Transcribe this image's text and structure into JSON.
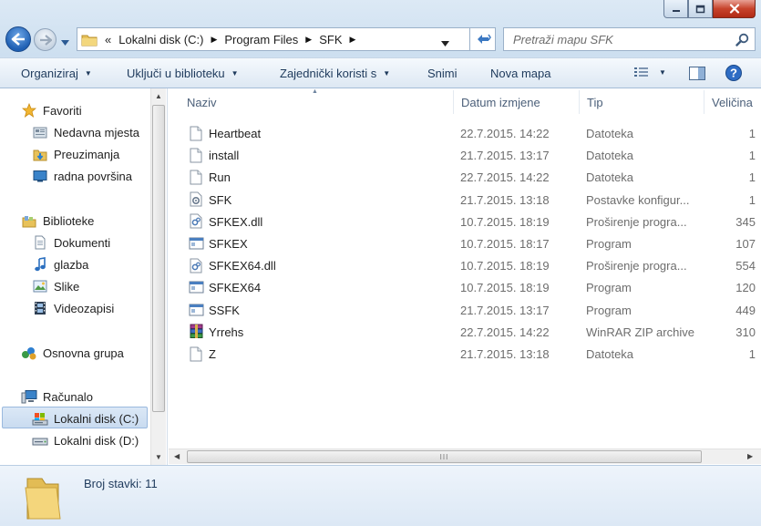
{
  "window": {
    "colors": {
      "accent": "#1e5fb3",
      "close": "#c7432c",
      "selection": "#cce0f6"
    }
  },
  "address": {
    "overflow": "«",
    "crumbs": [
      "Lokalni disk (C:)",
      "Program Files",
      "SFK"
    ]
  },
  "search": {
    "placeholder": "Pretraži mapu SFK"
  },
  "toolbar": {
    "organize": "Organiziraj",
    "include": "Uključi u biblioteku",
    "share": "Zajednički koristi s",
    "burn": "Snimi",
    "new_folder": "Nova mapa"
  },
  "nav": {
    "favorites": "Favoriti",
    "recent": "Nedavna mjesta",
    "downloads": "Preuzimanja",
    "desktop": "radna površina",
    "libraries": "Biblioteke",
    "documents": "Dokumenti",
    "music": "glazba",
    "pictures": "Slike",
    "videos": "Videozapisi",
    "homegroup": "Osnovna grupa",
    "computer": "Računalo",
    "drive_c": "Lokalni disk (C:)",
    "drive_d": "Lokalni disk (D:)"
  },
  "columns": {
    "name": "Naziv",
    "date": "Datum izmjene",
    "type": "Tip",
    "size": "Veličina"
  },
  "files": [
    {
      "name": "Heartbeat",
      "date": "22.7.2015. 14:22",
      "type": "Datoteka",
      "size": "1",
      "icon": "blank-file-icon"
    },
    {
      "name": "install",
      "date": "21.7.2015. 13:17",
      "type": "Datoteka",
      "size": "1",
      "icon": "blank-file-icon"
    },
    {
      "name": "Run",
      "date": "22.7.2015. 14:22",
      "type": "Datoteka",
      "size": "1",
      "icon": "blank-file-icon"
    },
    {
      "name": "SFK",
      "date": "21.7.2015. 13:18",
      "type": "Postavke konfigur...",
      "size": "1",
      "icon": "config-file-icon"
    },
    {
      "name": "SFKEX.dll",
      "date": "10.7.2015. 18:19",
      "type": "Proširenje progra...",
      "size": "345",
      "icon": "dll-file-icon"
    },
    {
      "name": "SFKEX",
      "date": "10.7.2015. 18:17",
      "type": "Program",
      "size": "107",
      "icon": "exe-file-icon"
    },
    {
      "name": "SFKEX64.dll",
      "date": "10.7.2015. 18:19",
      "type": "Proširenje progra...",
      "size": "554",
      "icon": "dll-file-icon"
    },
    {
      "name": "SFKEX64",
      "date": "10.7.2015. 18:19",
      "type": "Program",
      "size": "120",
      "icon": "exe-file-icon"
    },
    {
      "name": "SSFK",
      "date": "21.7.2015. 13:17",
      "type": "Program",
      "size": "449",
      "icon": "exe-file-icon"
    },
    {
      "name": "Yrrehs",
      "date": "22.7.2015. 14:22",
      "type": "WinRAR ZIP archive",
      "size": "310",
      "icon": "winrar-archive-icon"
    },
    {
      "name": "Z",
      "date": "21.7.2015. 13:18",
      "type": "Datoteka",
      "size": "1",
      "icon": "blank-file-icon"
    }
  ],
  "hscroll_grip": "III",
  "details": {
    "count": "Broj stavki: 11"
  }
}
